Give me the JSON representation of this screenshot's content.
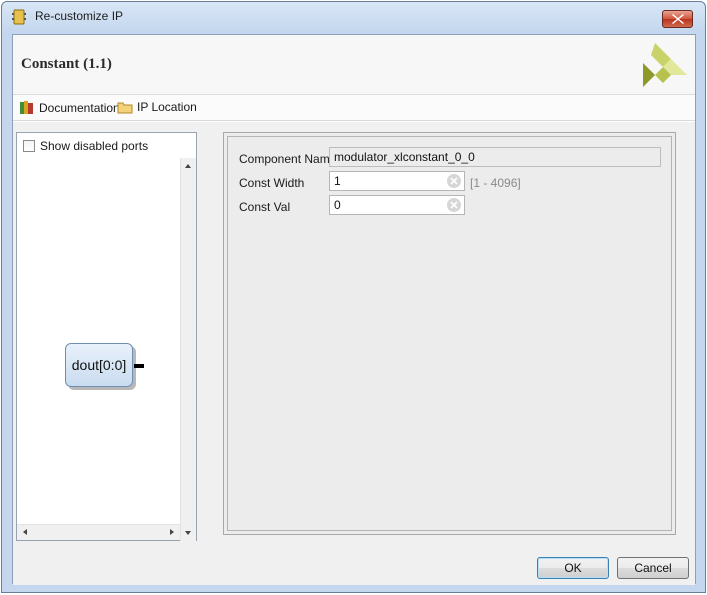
{
  "window": {
    "title": "Re-customize IP"
  },
  "header": {
    "title": "Constant (1.1)"
  },
  "toolbar": {
    "documentation_label": "Documentation",
    "ip_location_label": "IP Location"
  },
  "left_panel": {
    "show_disabled_ports_label": "Show disabled ports",
    "show_disabled_ports_checked": false,
    "port_label": "dout[0:0]"
  },
  "fields": {
    "component_name": {
      "label": "Component Name",
      "value": "modulator_xlconstant_0_0"
    },
    "const_width": {
      "label": "Const Width",
      "value": "1",
      "range": "[1 - 4096]"
    },
    "const_val": {
      "label": "Const Val",
      "value": "0"
    }
  },
  "buttons": {
    "ok": "OK",
    "cancel": "Cancel"
  },
  "icons": {
    "title": "ip-core-icon",
    "logo": "vendor-logo-icon",
    "documentation": "books-icon",
    "ip_location": "folder-icon",
    "clear": "clear-icon",
    "close": "close-icon"
  },
  "colors": {
    "logo_light": "#dbe37a",
    "logo_dark": "#8d9a2a"
  }
}
